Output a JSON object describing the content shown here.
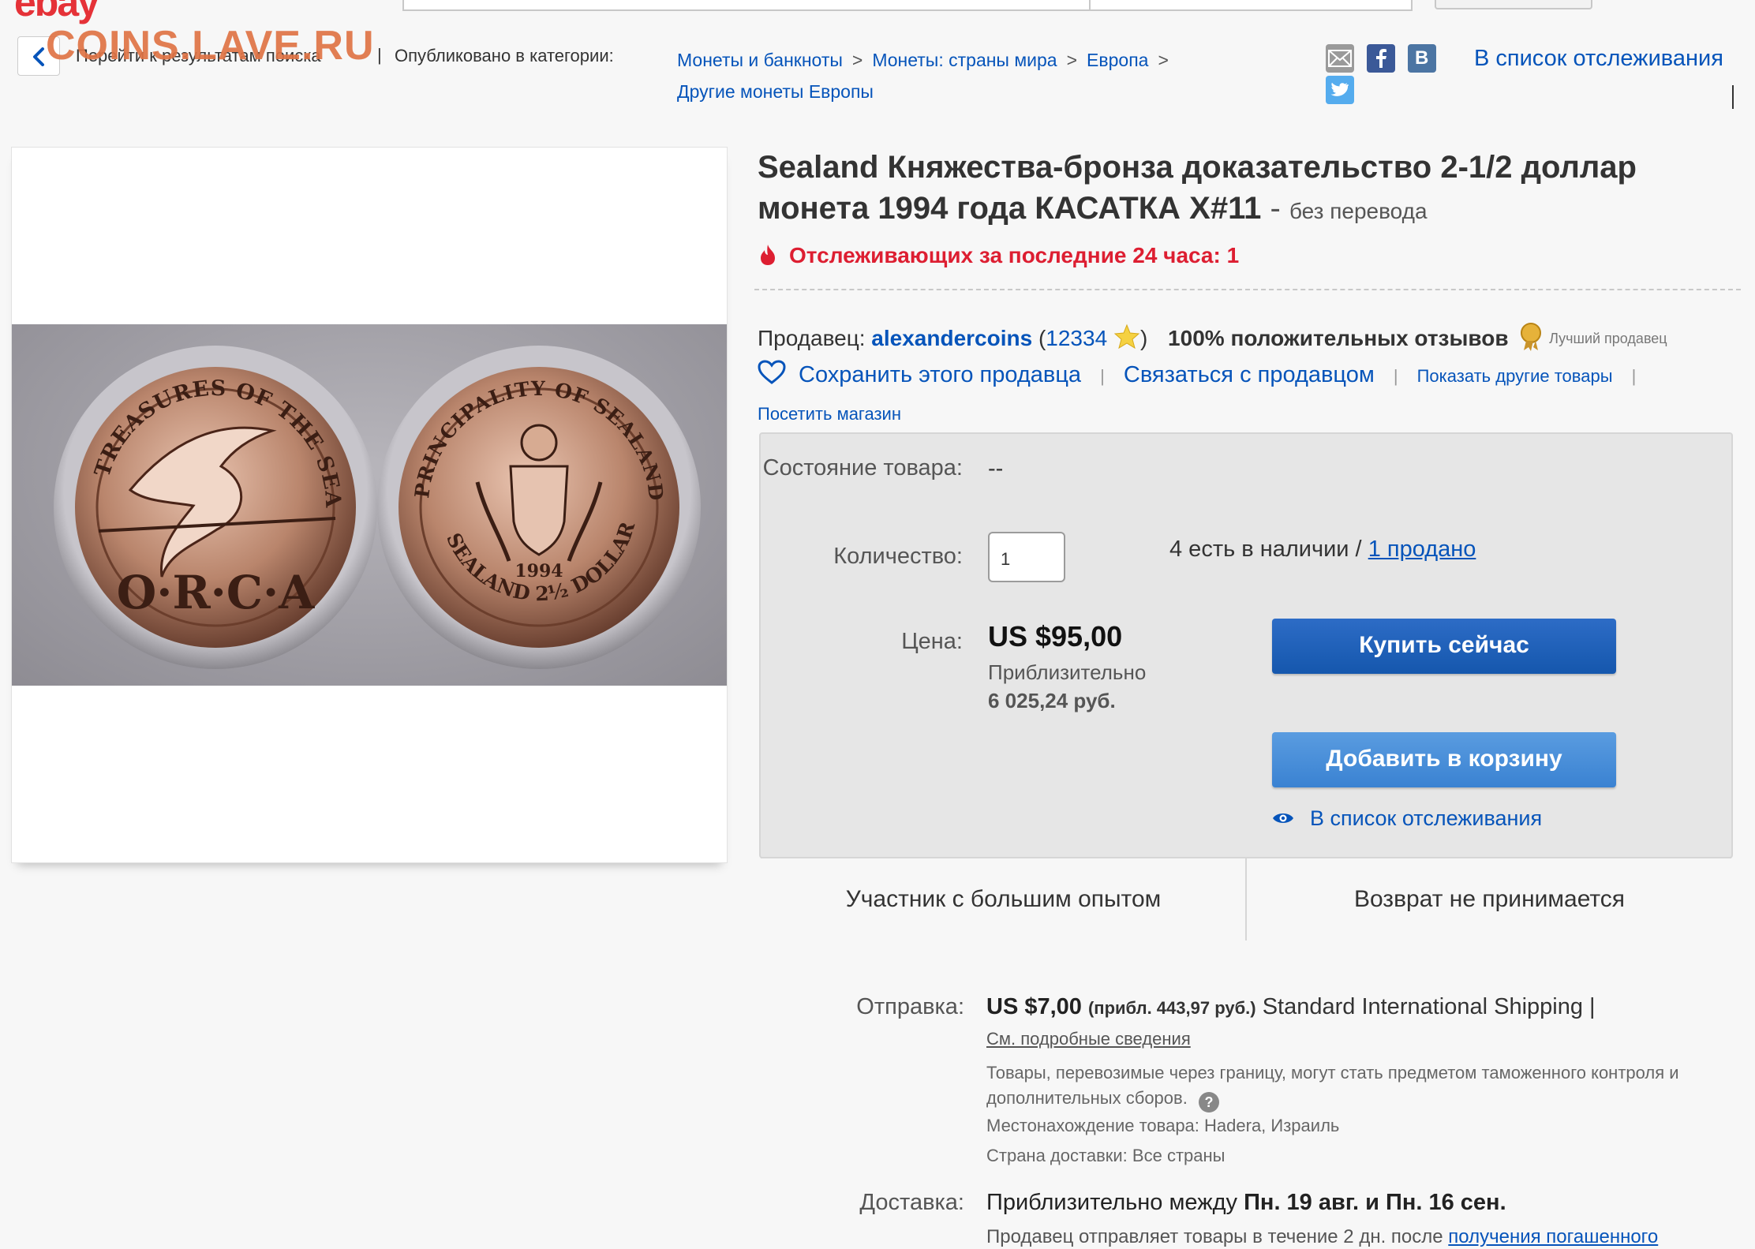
{
  "watermark": "COINS.LAVE.RU",
  "breadcrumb": {
    "back_label": "Перейти к результатам поиска",
    "divider": "|",
    "published_label": "Опубликовано в категории:",
    "separator": ">",
    "items": [
      "Монеты и банкноты",
      "Монеты: страны мира",
      "Европа",
      "Другие монеты Европы"
    ]
  },
  "share": {
    "icons": [
      "email-icon",
      "facebook-icon",
      "vk-icon",
      "twitter-icon"
    ],
    "vk_letter": "B"
  },
  "watchlist_top": "В список отслеживания",
  "listing": {
    "title": "Sealand Княжества-бронза доказательство 2-1/2 доллар монета 1994 года КАСАТКА X#11",
    "title_dash": "-",
    "no_translation": "без перевода",
    "watchers": "Отслеживающих за последние 24 часа: 1"
  },
  "seller": {
    "label": "Продавец:",
    "name": "alexandercoins",
    "open_paren": "(",
    "score": "12334",
    "close_paren": ")",
    "positive": "100% положительных отзывов",
    "top_seller": "Лучший продавец",
    "save": "Сохранить этого продавца",
    "contact": "Связаться с продавцом",
    "other_items": "Показать другие товары",
    "visit_store": "Посетить магазин",
    "sep": "|"
  },
  "buybox": {
    "condition_label": "Состояние товара:",
    "condition_value": "--",
    "quantity_label": "Количество:",
    "quantity_value": "1",
    "available": "4 есть в наличии /",
    "sold": "1 продано",
    "price_label": "Цена:",
    "price": "US $95,00",
    "approx_label": "Приблизительно",
    "approx_value": "6 025,24 руб.",
    "buy_now": "Купить сейчас",
    "add_to_cart": "Добавить в корзину",
    "watch": "В список отслеживания",
    "experienced": "Участник с большим опытом",
    "returns": "Возврат не принимается"
  },
  "shipping": {
    "label": "Отправка:",
    "cost": "US $7,00",
    "approx": "(прибл. 443,97 руб.)",
    "service": "Standard International Shipping |",
    "details_link": "См. подробные сведения",
    "customs_note": "Товары, перевозимые через границу, могут стать предметом таможенного контроля и дополнительных сборов.",
    "help_glyph": "?",
    "location_label": "Местонахождение товара:",
    "location": "Hadera, Израиль",
    "ships_to_label": "Страна доставки:",
    "ships_to": "Все страны"
  },
  "delivery": {
    "label": "Доставка:",
    "text_prefix": "Приблизительно между",
    "from": "Пн. 19 авг.",
    "and": "и",
    "to": "Пн. 16 сен.",
    "sub_prefix": "Продавец отправляет товары в течение 2 дн. после",
    "sub_link": "получения погашенного"
  },
  "coin_photo": {
    "left_top_text": "TREASURES OF THE SEA",
    "left_bottom_text": "O·R·C·A",
    "right_top_text": "PRINCIPALITY OF SEALAND",
    "right_year": "1994",
    "right_bottom_text": "SEALAND 2½ DOLLARS"
  },
  "colors": {
    "link": "#0654ba",
    "alert": "#dd1e31",
    "buy_button": "#1f62bd",
    "cart_button": "#4a90d9"
  }
}
